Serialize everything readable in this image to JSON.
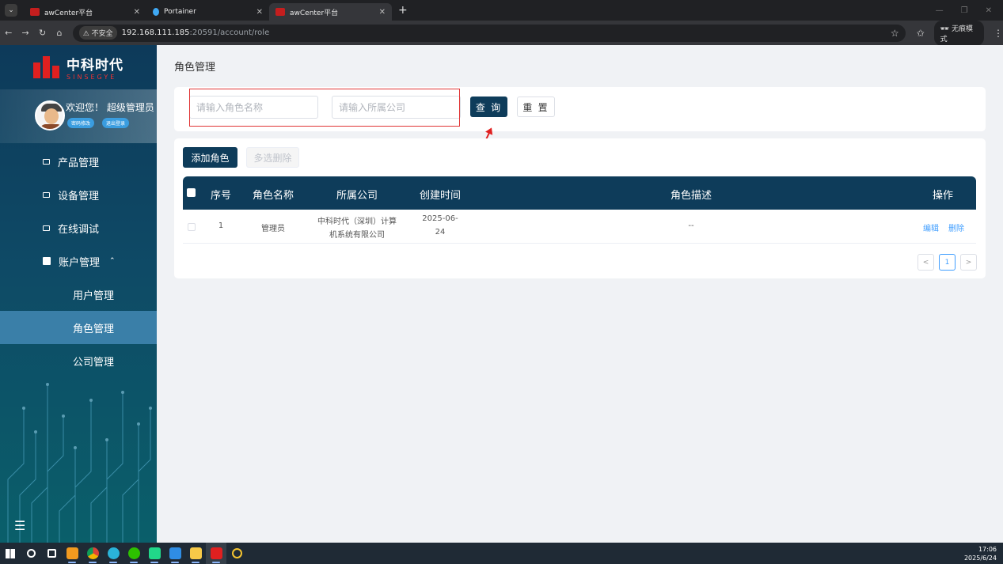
{
  "browser": {
    "tabs": [
      {
        "title": "awCenter平台",
        "active": false
      },
      {
        "title": "Portainer",
        "active": false
      },
      {
        "title": "awCenter平台",
        "active": true
      }
    ],
    "insecure_label": "不安全",
    "url_host": "192.168.111.185",
    "url_rest": ":20591/account/role",
    "incognito_label": "无痕模式"
  },
  "sidebar": {
    "logo_cn": "中科时代",
    "logo_en": "SINSEGYE",
    "welcome": "欢迎您！ 超级管理员",
    "btn_change_pwd": "密码修改",
    "btn_logout": "退出登录",
    "menu": [
      {
        "label": "产品管理",
        "icon": "monitor-icon"
      },
      {
        "label": "设备管理",
        "icon": "monitor-icon"
      },
      {
        "label": "在线调试",
        "icon": "monitor-icon"
      },
      {
        "label": "账户管理",
        "icon": "user-card-icon"
      }
    ],
    "submenu": [
      {
        "label": "用户管理",
        "active": false
      },
      {
        "label": "角色管理",
        "active": true
      },
      {
        "label": "公司管理",
        "active": false
      }
    ],
    "collapse_icon": "☰"
  },
  "main": {
    "page_title": "角色管理",
    "search": {
      "role_name_placeholder": "请输入角色名称",
      "company_placeholder": "请输入所属公司",
      "query_label": "查 询",
      "reset_label": "重 置"
    },
    "toolbar": {
      "add_label": "添加角色",
      "batch_delete_label": "多选删除"
    },
    "table": {
      "headers": [
        "序号",
        "角色名称",
        "所属公司",
        "创建时间",
        "角色描述",
        "操作"
      ],
      "rows": [
        {
          "index": "1",
          "role_name": "管理员",
          "company_line1": "中科时代（深圳）计算",
          "company_line2": "机系统有限公司",
          "created_line1": "2025-06-",
          "created_line2": "24",
          "description": "--",
          "edit_label": "编辑",
          "delete_label": "删除"
        }
      ]
    },
    "pager": {
      "prev": "<",
      "current": "1",
      "next": ">"
    }
  },
  "taskbar": {
    "time": "17:06",
    "date": "2025/6/24"
  },
  "colors": {
    "primary": "#0e3c5a",
    "link": "#409eff",
    "highlight": "#e03434"
  }
}
